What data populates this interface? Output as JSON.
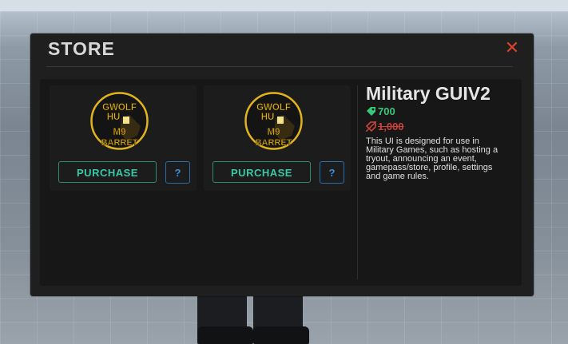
{
  "store": {
    "title": "STORE",
    "close_label": "✕"
  },
  "items": [
    {
      "logo_lines": [
        "GWOLF",
        "HU",
        "M9",
        "BARRET"
      ],
      "purchase_label": "PURCHASE",
      "help_label": "?"
    },
    {
      "logo_lines": [
        "GWOLF",
        "HU",
        "M9",
        "BARRET"
      ],
      "purchase_label": "PURCHASE",
      "help_label": "?"
    }
  ],
  "detail": {
    "name": "Military GUIV2",
    "price": "700",
    "old_price": "1,000",
    "price_icon": "gem-tag-icon",
    "old_price_icon": "robux-tag-icon",
    "description_lines": [
      "This UI is designed for use in",
      "Military Games, such as hosting a",
      "tryout, announcing an event,",
      "gamepass/store, profile, settings",
      "and game rules."
    ]
  },
  "colors": {
    "accent_green": "#38c8a8",
    "price_green": "#38c878",
    "sale_red": "#c9423a",
    "close_red": "#d9452b",
    "help_blue": "#3a8fd6",
    "logo_gold": "#e0b41a"
  }
}
